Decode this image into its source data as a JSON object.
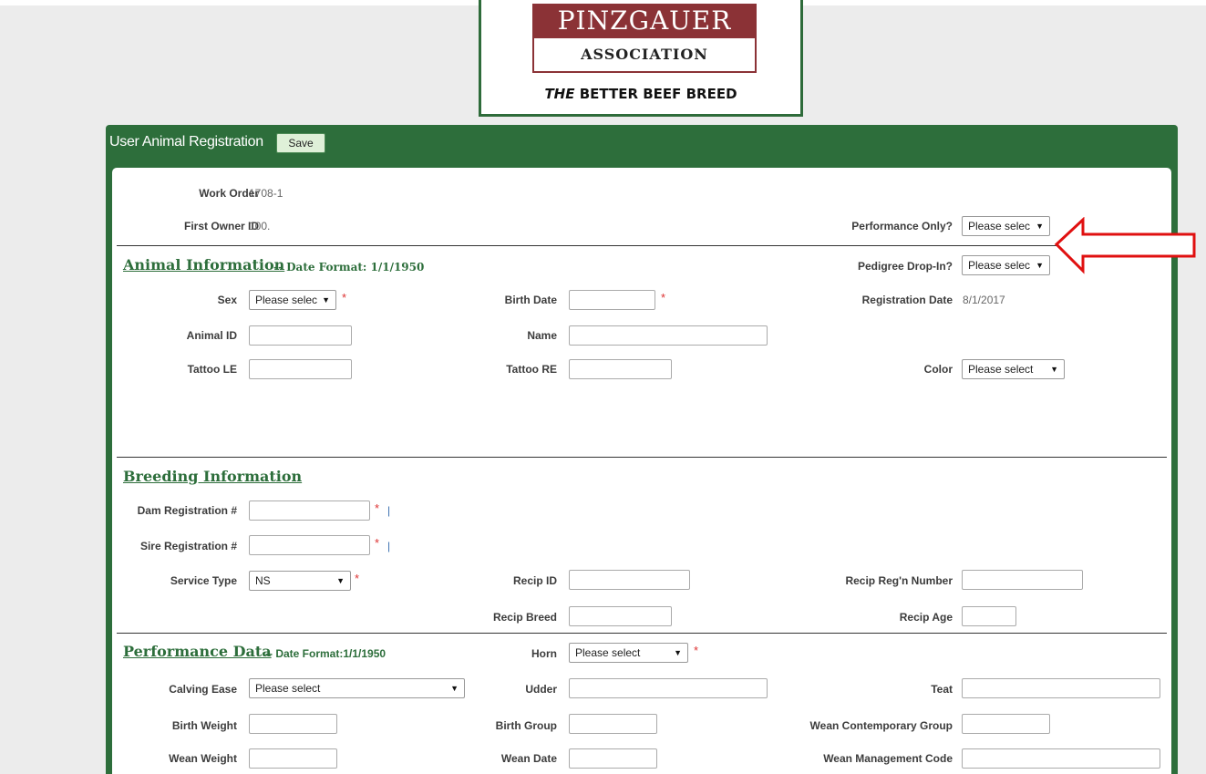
{
  "logo": {
    "line1": "PINZGAUER",
    "line2": "ASSOCIATION",
    "tag_em": "THE",
    "tag_rest": " BETTER BEEF BREED"
  },
  "panel": {
    "title": "User Animal Registration",
    "save_label": "Save"
  },
  "header_fields": {
    "work_order_label": "Work Order",
    "work_order_value": "1708-1",
    "first_owner_label": "First Owner ID",
    "first_owner_value": "100.",
    "performance_only_label": "Performance Only?",
    "performance_only_value": "Please selec",
    "pedigree_dropin_label": "Pedigree Drop-In?",
    "pedigree_dropin_value": "Please selec"
  },
  "animal_info": {
    "title": "Animal Information",
    "note": "-- Date Format: 1/1/1950",
    "sex_label": "Sex",
    "sex_value": "Please selec",
    "birth_date_label": "Birth Date",
    "registration_date_label": "Registration Date",
    "registration_date_value": "8/1/2017",
    "animal_id_label": "Animal ID",
    "name_label": "Name",
    "tattoo_le_label": "Tattoo LE",
    "tattoo_re_label": "Tattoo RE",
    "color_label": "Color",
    "color_value": "Please select"
  },
  "breeding_info": {
    "title": "Breeding Information",
    "dam_label": "Dam Registration #",
    "sire_label": "Sire Registration #",
    "service_type_label": "Service Type",
    "service_type_value": "NS",
    "recip_id_label": "Recip ID",
    "recip_reg_label": "Recip Reg'n Number",
    "recip_breed_label": "Recip Breed",
    "recip_age_label": "Recip Age"
  },
  "performance_data": {
    "title": "Performance Data",
    "note": "-- Date Format:1/1/1950",
    "horn_label": "Horn",
    "horn_value": "Please select",
    "calving_ease_label": "Calving Ease",
    "calving_ease_value": "Please select",
    "udder_label": "Udder",
    "teat_label": "Teat",
    "birth_weight_label": "Birth Weight",
    "birth_group_label": "Birth Group",
    "wean_cg_label": "Wean Contemporary Group",
    "wean_weight_label": "Wean Weight",
    "wean_date_label": "Wean Date",
    "wean_mgmt_label": "Wean Management Code"
  },
  "required_marker": "*",
  "pipe_marker": "|",
  "dropdown_arrow": "▼",
  "colors": {
    "brand_green": "#2d6e3b",
    "logo_red": "#8b3236",
    "required": "#dd3333",
    "annotation_arrow": "#e01010"
  }
}
